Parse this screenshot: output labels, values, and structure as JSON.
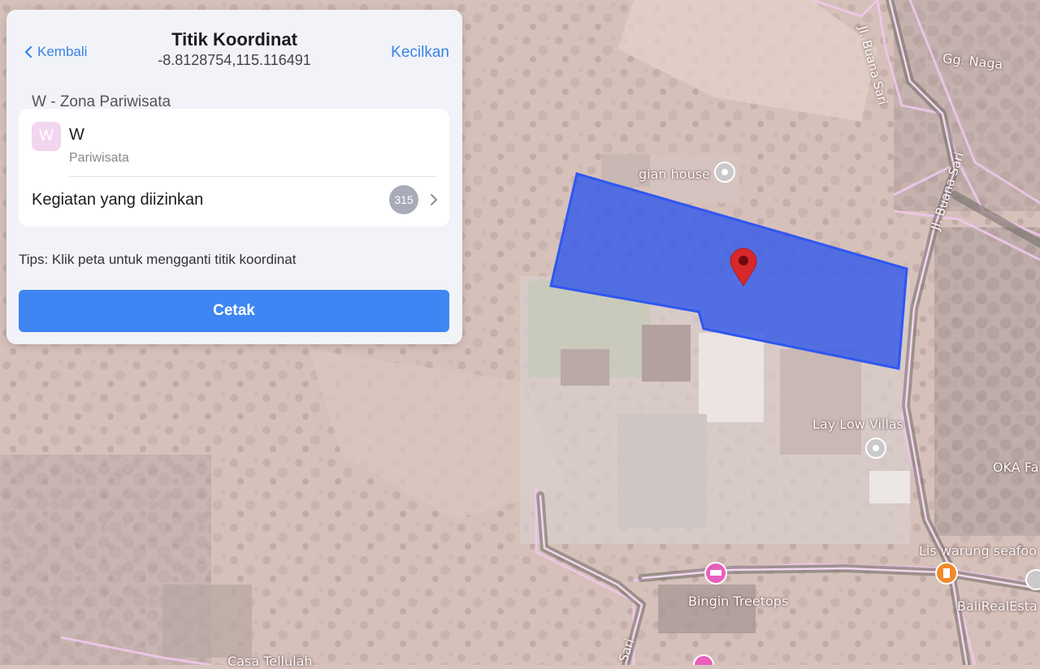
{
  "header": {
    "back_label": "Kembali",
    "title": "Titik Koordinat",
    "coordinates": "-8.8128754,115.116491",
    "minimize_label": "Kecilkan"
  },
  "zone": {
    "heading": "W - Zona Pariwisata",
    "badge_letter": "W",
    "code": "W",
    "name": "Pariwisata",
    "badge_color": "#f2d6ef"
  },
  "activities": {
    "label": "Kegiatan yang diizinkan",
    "count": "315"
  },
  "tips": "Tips: Klik peta untuk mengganti titik koordinat",
  "print_label": "Cetak",
  "map": {
    "labels": {
      "gg_naga": "Gg. Naga",
      "gian_house": "gian house",
      "lay_low_villas": "Lay Low Villas",
      "oka": "OKA Fa",
      "lis_warung": "Lis warung seafoo",
      "bingin_treetops": "Bingin Treetops",
      "bali_real_estate": "BaliRealEsta",
      "casa_tellulah": "Casa Tellulah",
      "road_buana_sari_1": "Jl. Buana Sari",
      "road_buana_sari_2": "Jl. Buana Sari",
      "road_sari": "Sari"
    },
    "colors": {
      "parcel_fill": "#3b5ee8",
      "zone_overlay": "#f0c8ea",
      "pin": "#d8282a",
      "accent": "#3f85f3"
    }
  }
}
